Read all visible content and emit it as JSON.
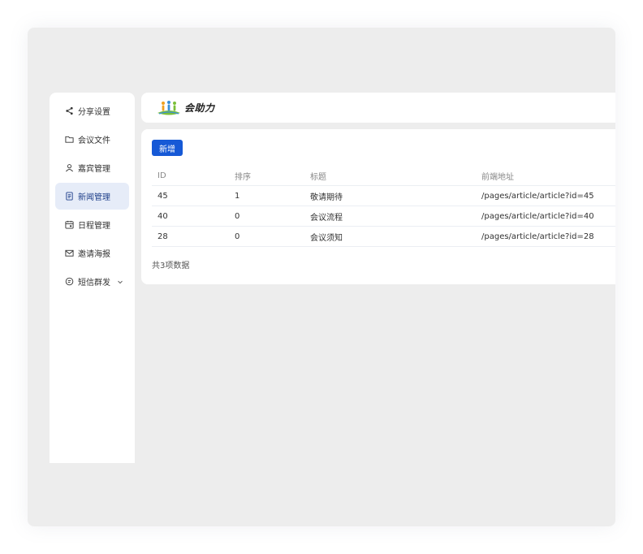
{
  "colors": {
    "accent": "#1659d6",
    "active_bg": "#e6ecf8",
    "canvas": "#ededed"
  },
  "sidebar": {
    "items": [
      {
        "label": "分享设置",
        "icon": "share-icon"
      },
      {
        "label": "会议文件",
        "icon": "folder-icon"
      },
      {
        "label": "嘉宾管理",
        "icon": "user-icon"
      },
      {
        "label": "新闻管理",
        "icon": "news-icon",
        "active": true
      },
      {
        "label": "日程管理",
        "icon": "calendar-icon"
      },
      {
        "label": "邀请海报",
        "icon": "mail-icon"
      },
      {
        "label": "短信群发",
        "icon": "message-icon",
        "expandable": true
      }
    ]
  },
  "header": {
    "logo_text": "会助力"
  },
  "toolbar": {
    "add_label": "新增"
  },
  "table": {
    "columns": [
      "ID",
      "排序",
      "标题",
      "前端地址"
    ],
    "rows": [
      {
        "id": "45",
        "sort": "1",
        "title": "敬请期待",
        "url": "/pages/article/article?id=45"
      },
      {
        "id": "40",
        "sort": "0",
        "title": "会议流程",
        "url": "/pages/article/article?id=40"
      },
      {
        "id": "28",
        "sort": "0",
        "title": "会议须知",
        "url": "/pages/article/article?id=28"
      }
    ]
  },
  "footer": {
    "count_text": "共3项数据"
  }
}
